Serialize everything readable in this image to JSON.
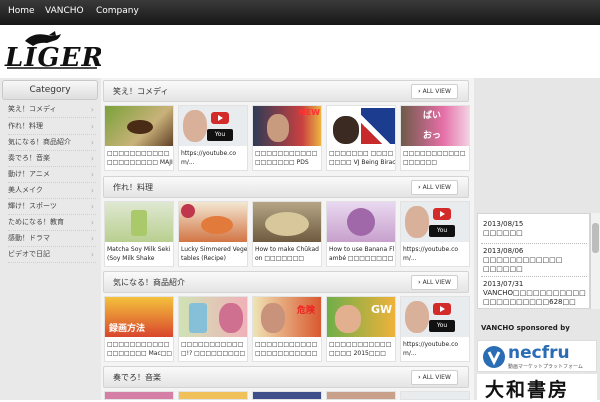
{
  "nav": {
    "items": [
      "Home",
      "VANCHO",
      "Company"
    ]
  },
  "logo": {
    "text": "LIGER"
  },
  "sidebar": {
    "title": "Category",
    "items": [
      "笑え！コメディ",
      "作れ！料理",
      "気になる！商品紹介",
      "奏でろ！音楽",
      "動け！アニメ",
      "美人メイク",
      "輝け！スポーツ",
      "ためになる！教育",
      "感動！ドラマ",
      "ビデオで日記"
    ]
  },
  "sections": [
    {
      "title": "笑え！コメディ",
      "all_view": "ALL VIEW",
      "cards": [
        {
          "title": "□□□□□□□□□□□□□□□□□□□□ MAJIDE"
        },
        {
          "title": "https://youtube.com/..."
        },
        {
          "title": "□□□□□□□□□□□□□□□□□□ PDS"
        },
        {
          "title": "□□□□□□□ □□□□□□□□ VJ Being Biracial In"
        },
        {
          "title": "□□□□□□□□□□□□□□□□□"
        }
      ]
    },
    {
      "title": "作れ！料理",
      "all_view": "ALL VIEW",
      "cards": [
        {
          "title": "Matcha Soy Milk Seki (Soy Milk Shake"
        },
        {
          "title": "Lucky Simmered Vegetables (Recipe)"
        },
        {
          "title": "How to make Chūkadon □□□□□□□"
        },
        {
          "title": "How to use Banana Flambé □□□□□□□□□"
        },
        {
          "title": "https://youtube.com/..."
        }
      ]
    },
    {
      "title": "気になる！商品紹介",
      "all_view": "ALL VIEW",
      "cards": [
        {
          "title": "□□□□□□□□□□□□□□□□□□ Mac□□□□□□□□□□□□□□"
        },
        {
          "title": "□□□□□□□□□□□□!? □□□□□□□□□□□□□"
        },
        {
          "title": "□□□□□□□□□□□□□□□□□□□□□□□□□□"
        },
        {
          "title": "□□□□□□□□□□□□□□□ 2015□□□"
        },
        {
          "title": "https://youtube.com/..."
        }
      ]
    },
    {
      "title": "奏でろ！音楽",
      "all_view": "ALL VIEW",
      "cards": []
    }
  ],
  "news": [
    {
      "date": "2013/08/15",
      "text": "□□□□□□"
    },
    {
      "date": "2013/08/06",
      "text": "□□□□□□□□□□□□ □□□□□□"
    },
    {
      "date": "2013/07/31",
      "text": "VANCHO□□□□□□□□□□□ □□□□□□□□□□628□□"
    }
  ],
  "sponsor": {
    "label": "VANCHO sponsored by",
    "necfru": {
      "name": "necfru",
      "sub": "動画マーケットプラットフォーム"
    },
    "yamato": {
      "name": "大和書房"
    }
  },
  "icons": {
    "arrow": "chevron-right-icon",
    "allview": "circle-chevron-icon",
    "youtube": "youtube-logo-icon"
  },
  "colors": {
    "nav_bg": "#1f1f1f",
    "sidebar_bg": "#e9e9e9",
    "main_bg": "#f4f4f4",
    "youtube_red": "#d32a2a",
    "necfru_blue": "#2a6db5"
  }
}
